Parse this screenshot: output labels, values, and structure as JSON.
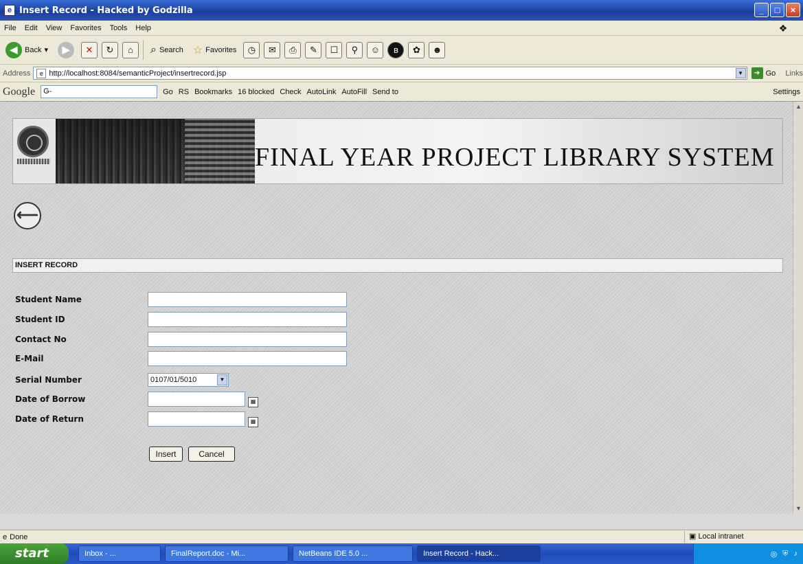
{
  "window": {
    "title": "Insert Record - Hacked by Godzilla"
  },
  "menu": [
    "File",
    "Edit",
    "View",
    "Favorites",
    "Tools",
    "Help"
  ],
  "toolbar": {
    "back": "Back",
    "search": "Search",
    "favorites": "Favorites"
  },
  "address": {
    "label": "Address",
    "url": "http://localhost:8084/semanticProject/insertrecord.jsp",
    "go": "Go",
    "links": "Links"
  },
  "google": {
    "logo": "Google",
    "search_value": "G-",
    "go": "Go",
    "rs": "RS",
    "bookmarks": "Bookmarks",
    "blocked": "16 blocked",
    "check": "Check",
    "autolink": "AutoLink",
    "autofill": "AutoFill",
    "sendto": "Send to",
    "settings": "Settings"
  },
  "banner": {
    "title": "FINAL YEAR PROJECT LIBRARY SYSTEM"
  },
  "section": {
    "title": "INSERT RECORD"
  },
  "form": {
    "student_name": {
      "label": "Student Name",
      "value": ""
    },
    "student_id": {
      "label": "Student ID",
      "value": ""
    },
    "contact_no": {
      "label": "Contact No",
      "value": ""
    },
    "email": {
      "label": "E-Mail",
      "value": ""
    },
    "serial_number": {
      "label": "Serial Number",
      "selected": "0107/01/5010"
    },
    "date_borrow": {
      "label": "Date of Borrow",
      "value": ""
    },
    "date_return": {
      "label": "Date of Return",
      "value": ""
    }
  },
  "buttons": {
    "insert": "Insert",
    "cancel": "Cancel"
  },
  "status": {
    "text": "Done",
    "zone": "Local intranet"
  },
  "taskbar": {
    "start": "start",
    "tasks": [
      "Inbox - ...",
      "FinalReport.doc - Mi...",
      "NetBeans IDE 5.0 ...",
      "Insert Record - Hack..."
    ]
  }
}
